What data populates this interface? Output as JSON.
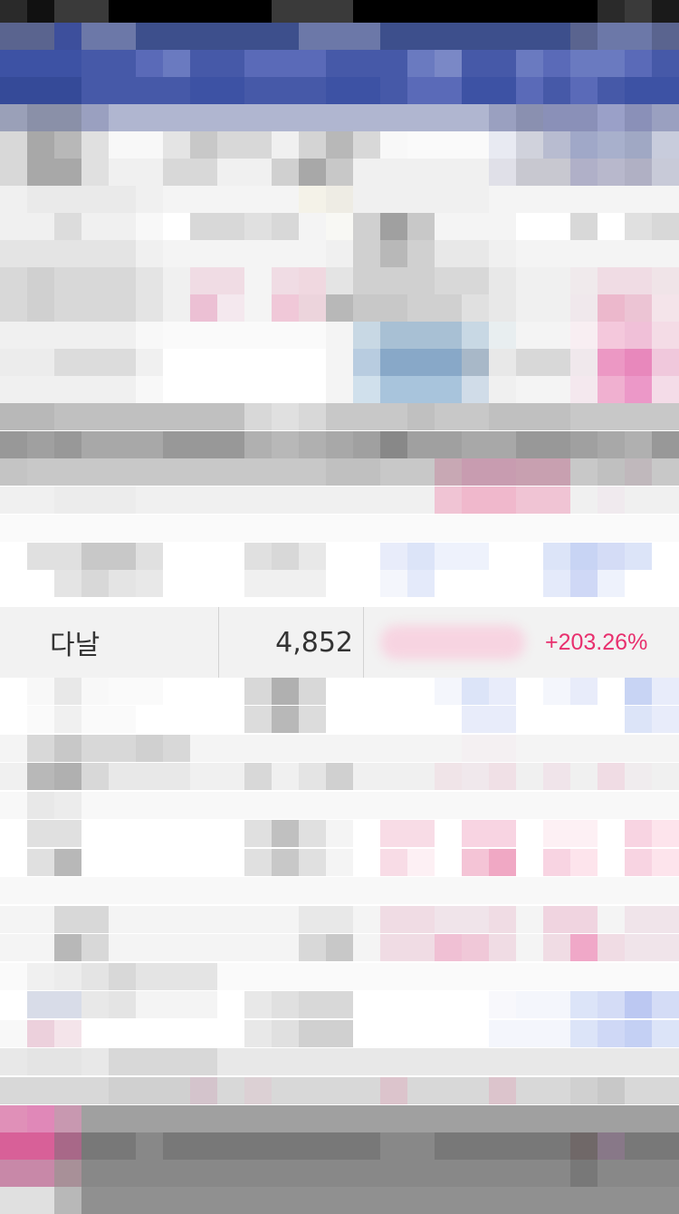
{
  "stock_row": {
    "name": "다날",
    "price": "4,852",
    "change": "+203.26%"
  },
  "colors": {
    "header_blue": "#3d4f9c",
    "change_positive": "#e8306e",
    "row_bg": "#f2f2f2"
  }
}
